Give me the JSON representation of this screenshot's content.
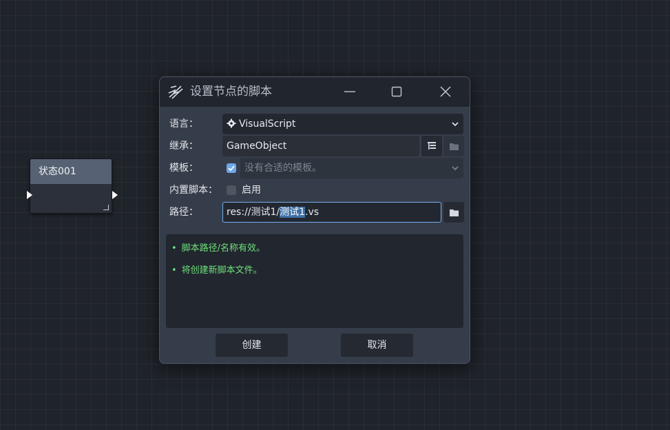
{
  "graph_node": {
    "title": "状态001"
  },
  "dialog": {
    "title": "设置节点的脚本",
    "language": {
      "label": "语言：",
      "value": "VisualScript",
      "icon": "gear-icon"
    },
    "inherits": {
      "label": "继承：",
      "value": "GameObject"
    },
    "template": {
      "label": "模板：",
      "checked": true,
      "value": "没有合适的模板。"
    },
    "builtin": {
      "label": "内置脚本：",
      "checked": false,
      "option_label": "启用"
    },
    "path": {
      "label": "路径：",
      "prefix": "res://测试1/",
      "selected": "测试1",
      "suffix": ".vs"
    },
    "messages": [
      {
        "bullet": "•",
        "text": "脚本路径/名称有效。"
      },
      {
        "bullet": "•",
        "text": "将创建新脚本文件。"
      }
    ],
    "buttons": {
      "create": "创建",
      "cancel": "取消"
    }
  },
  "colors": {
    "accent": "#6fa7e8",
    "message_ok": "#6ee07d",
    "canvas_bg": "#1f232a",
    "dialog_bg": "#363d4a"
  }
}
